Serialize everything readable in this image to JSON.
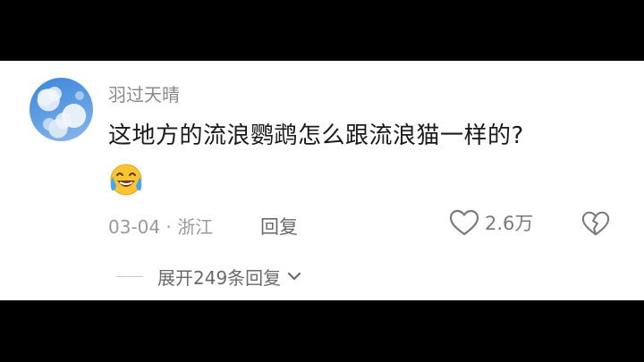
{
  "comment": {
    "username": "羽过天晴",
    "text": "这地方的流浪鹦鹉怎么跟流浪猫一样的?",
    "emoji": "crying-laughing-emoji",
    "date_location": "03-04 · 浙江",
    "reply_label": "回复",
    "like_count": "2.6万",
    "expand_replies_label": "展开249条回复"
  },
  "icons": {
    "like": "heart-outline-icon",
    "dislike": "broken-heart-icon",
    "expand": "chevron-down-icon"
  },
  "colors": {
    "card_background": "#ffffff",
    "letterbox": "#000000",
    "username": "#8a8a8a",
    "comment_text": "#1a1a1a",
    "meta_text": "#9a9a9a"
  }
}
